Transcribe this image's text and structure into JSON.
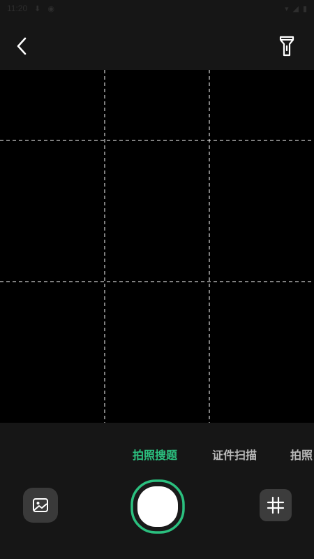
{
  "status_bar": {
    "time": "11:20",
    "icons": [
      "download-icon",
      "app-icon",
      "wifi-icon",
      "signal-icon",
      "battery-icon"
    ]
  },
  "top_bar": {
    "back_icon": "chevron-left-icon",
    "flash_icon": "flashlight-icon"
  },
  "modes": [
    {
      "label": "拍照搜题",
      "active": true
    },
    {
      "label": "证件扫描",
      "active": false
    },
    {
      "label": "拍照",
      "active": false
    }
  ],
  "controls": {
    "gallery_icon": "image-icon",
    "grid_icon": "grid-icon",
    "shutter_icon": "shutter-icon"
  },
  "colors": {
    "accent": "#2bc07f",
    "background": "#161616",
    "viewfinder": "#000000"
  }
}
